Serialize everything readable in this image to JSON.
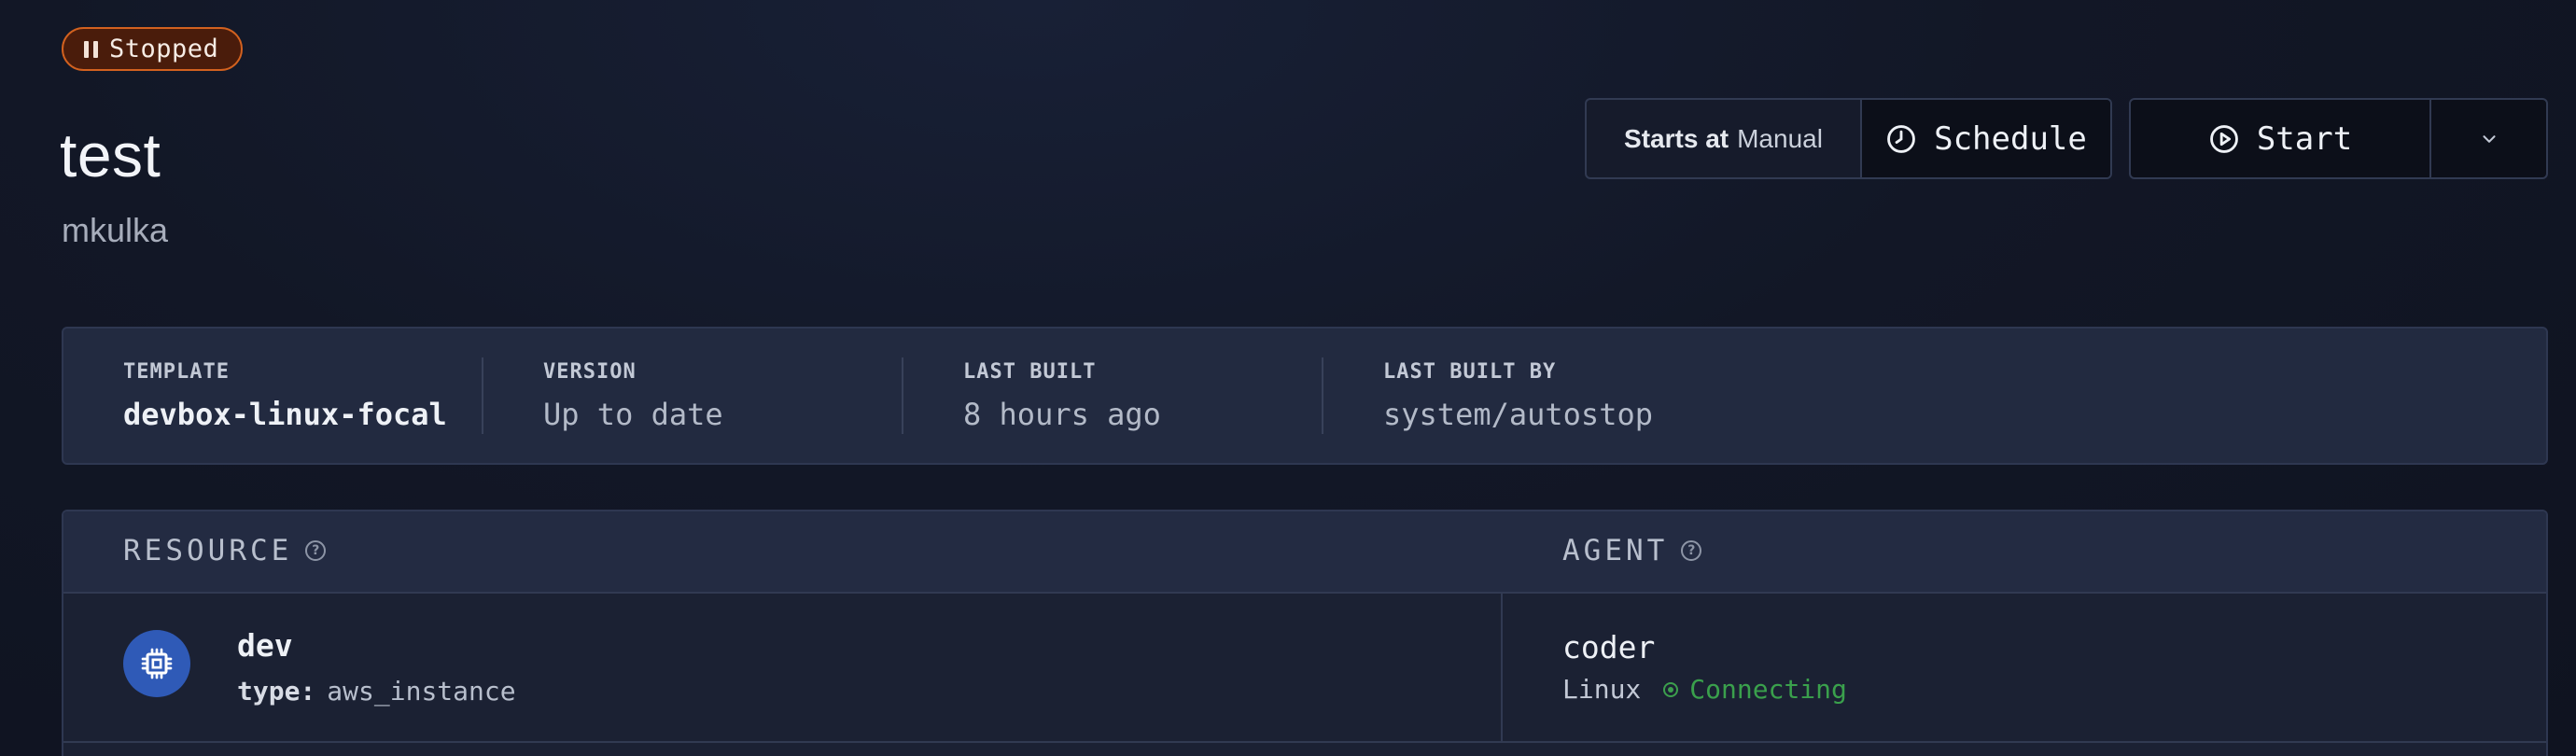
{
  "status": {
    "label": "Stopped",
    "icon": "pause-icon",
    "color": "#d2611f"
  },
  "workspace": {
    "name": "test",
    "owner": "mkulka"
  },
  "schedule": {
    "starts_at_label": "Starts at",
    "starts_at_value": "Manual",
    "schedule_label": "Schedule",
    "icon": "clock-icon"
  },
  "actions": {
    "start_label": "Start",
    "start_icon": "play-circle-icon",
    "dropdown_icon": "chevron-down-icon"
  },
  "stats": [
    {
      "label": "TEMPLATE",
      "value": "devbox-linux-focal"
    },
    {
      "label": "VERSION",
      "value": "Up to date"
    },
    {
      "label": "LAST BUILT",
      "value": "8 hours ago"
    },
    {
      "label": "LAST BUILT BY",
      "value": "system/autostop"
    }
  ],
  "resources": {
    "headers": {
      "resource": "RESOURCE",
      "agent": "AGENT"
    },
    "rows": [
      {
        "name": "dev",
        "type_label": "type:",
        "type_value": "aws_instance",
        "icon": "cpu-icon",
        "agent": {
          "name": "coder",
          "os": "Linux",
          "status": "Connecting",
          "status_color": "#3aa04c"
        }
      }
    ]
  }
}
